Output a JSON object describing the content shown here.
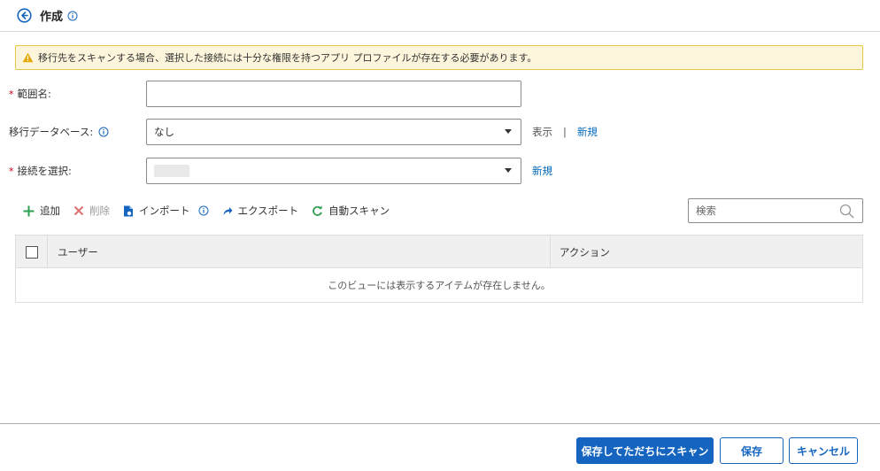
{
  "header": {
    "title": "作成"
  },
  "warning": {
    "text": "移行先をスキャンする場合、選択した接続には十分な権限を持つアプリ プロファイルが存在する必要があります。"
  },
  "form": {
    "scope_name": {
      "label": "範囲名:",
      "required": "*",
      "value": ""
    },
    "migration_db": {
      "label": "移行データベース:",
      "value": "なし",
      "view_link": "表示",
      "separator": "|",
      "new_link": "新規"
    },
    "connection": {
      "label": "接続を選択:",
      "required": "*",
      "value": "",
      "new_link": "新規"
    }
  },
  "toolbar": {
    "add": "追加",
    "delete": "削除",
    "import": "インポート",
    "export": "エクスポート",
    "auto_scan": "自動スキャン",
    "search_placeholder": "検索"
  },
  "table": {
    "columns": [
      "ユーザー",
      "アクション"
    ],
    "empty_message": "このビューには表示するアイテムが存在しません。"
  },
  "footer": {
    "save_scan": "保存してただちにスキャン",
    "save": "保存",
    "cancel": "キャンセル"
  },
  "colors": {
    "accent": "#1565c0",
    "link": "#0067b8",
    "warning_bg": "#fdf6dc",
    "warning_border": "#e8c547",
    "add_green": "#2e9e4f",
    "delete_red": "#e07070"
  }
}
